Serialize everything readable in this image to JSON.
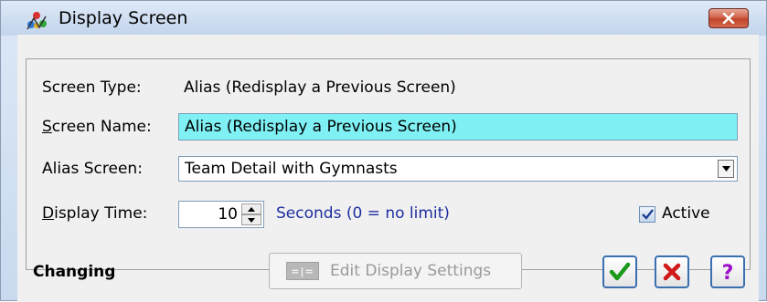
{
  "window": {
    "title": "Display Screen",
    "icon": "gymnasts-app-icon",
    "close_icon": "close-icon"
  },
  "form": {
    "screen_type_label": "Screen Type:",
    "screen_type_value": "Alias (Redisplay a Previous Screen)",
    "screen_name_label_u": "S",
    "screen_name_label_rest": "creen Name:",
    "screen_name_value": "Alias (Redisplay a Previous Screen)",
    "alias_screen_label": "Alias Screen:",
    "alias_screen_value": "Team Detail with Gymnasts",
    "display_time_label_u": "D",
    "display_time_label_rest": "isplay Time:",
    "display_time_value": "10",
    "seconds_hint": "Seconds (0 = no limit)",
    "active_label": "Active",
    "active_checked": true
  },
  "footer": {
    "status": "Changing",
    "edit_button_label": "Edit Display Settings",
    "edit_button_enabled": false,
    "ok_icon": "check-icon",
    "cancel_icon": "x-icon",
    "help_icon": "question-icon"
  },
  "colors": {
    "screen_name_bg": "#7ff1f4",
    "hint_text": "#1f2fa0",
    "ok_green": "#1a9a1a",
    "cancel_red": "#d01818",
    "help_purple": "#9b10c8",
    "close_red": "#c0442a"
  }
}
